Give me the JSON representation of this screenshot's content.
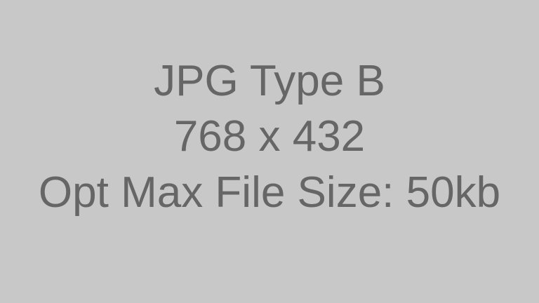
{
  "placeholder": {
    "line1": "JPG Type B",
    "line2": "768 x 432",
    "line3": "Opt Max File Size: 50kb"
  },
  "colors": {
    "background": "#c8c8c8",
    "text": "#666666"
  }
}
